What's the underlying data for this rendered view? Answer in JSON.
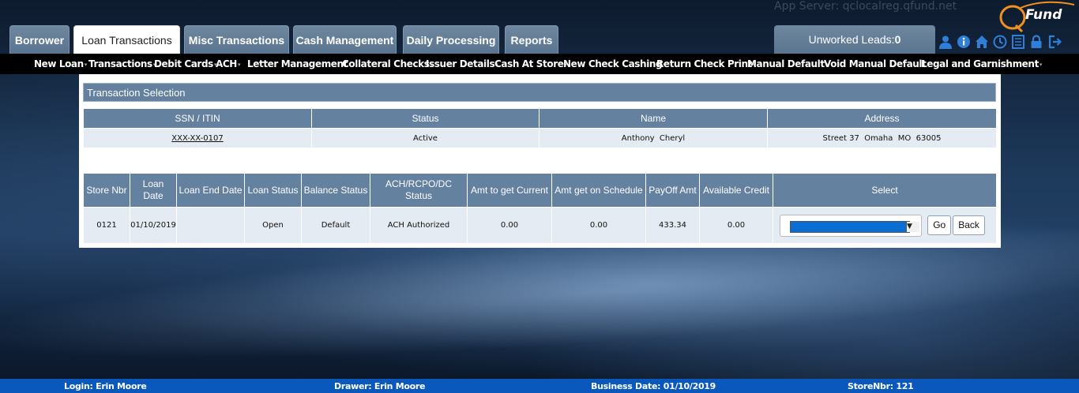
{
  "header": {
    "app_server": "App Server: qclocalreg.qfund.net",
    "logo_text": "Fund",
    "tabs": [
      {
        "label": "Borrower"
      },
      {
        "label": "Loan Transactions"
      },
      {
        "label": "Misc Transactions"
      },
      {
        "label": "Cash Management"
      },
      {
        "label": "Daily Processing"
      },
      {
        "label": "Reports"
      }
    ],
    "leads_label": "Unworked Leads:",
    "leads_count": "0",
    "icons": [
      "user-icon",
      "info-icon",
      "home-icon",
      "clock-icon",
      "list-icon",
      "lock-icon",
      "logout-icon"
    ]
  },
  "menu": [
    {
      "label": "New Loan"
    },
    {
      "label": "Transactions"
    },
    {
      "label": "Debit Cards"
    },
    {
      "label": "ACH"
    },
    {
      "label": "Letter Management"
    },
    {
      "label": "Collateral Checks"
    },
    {
      "label": "Issuer Details"
    },
    {
      "label": "Cash At Store"
    },
    {
      "label": "New Check Cashing"
    },
    {
      "label": "Return Check Print"
    },
    {
      "label": "Manual Default"
    },
    {
      "label": "Void Manual Default"
    },
    {
      "label": "Legal and Garnishment"
    }
  ],
  "section_title": "Transaction Selection",
  "customer_table": {
    "headers": [
      "SSN / ITIN",
      "Status",
      "Name",
      "Address"
    ],
    "row": {
      "ssn": "XXX-XX-0107",
      "status": "Active",
      "name": "Anthony  Cheryl",
      "address": "Street 37  Omaha  MO  63005"
    }
  },
  "loan_table": {
    "headers": [
      "Store Nbr",
      "Loan Date",
      "Loan End Date",
      "Loan Status",
      "Balance Status",
      "ACH/RCPO/DC Status",
      "Amt to get Current",
      "Amt get on Schedule",
      "PayOff Amt",
      "Available Credit",
      "Select"
    ],
    "row": {
      "store_nbr": "0121",
      "loan_date": "01/10/2019",
      "loan_end_date": "",
      "loan_status": "Open",
      "balance_status": "Default",
      "ach_status": "ACH Authorized",
      "amt_current": "0.00",
      "amt_schedule": "0.00",
      "payoff_amt": "433.34",
      "available_credit": "0.00"
    },
    "go_label": "Go",
    "back_label": "Back"
  },
  "footer": {
    "login": "Login: Erin Moore",
    "drawer": "Drawer: Erin Moore",
    "business_date": "Business Date: 01/10/2019",
    "store_nbr": "StoreNbr: 121"
  },
  "colors": {
    "tab_bg": "#5f7a95",
    "header_bg": "#6481a0",
    "menubar_bg": "#000000",
    "footer_bg": "#0b58bd",
    "select_highlight": "#0a6fd0",
    "logo_orange": "#f0901e"
  }
}
